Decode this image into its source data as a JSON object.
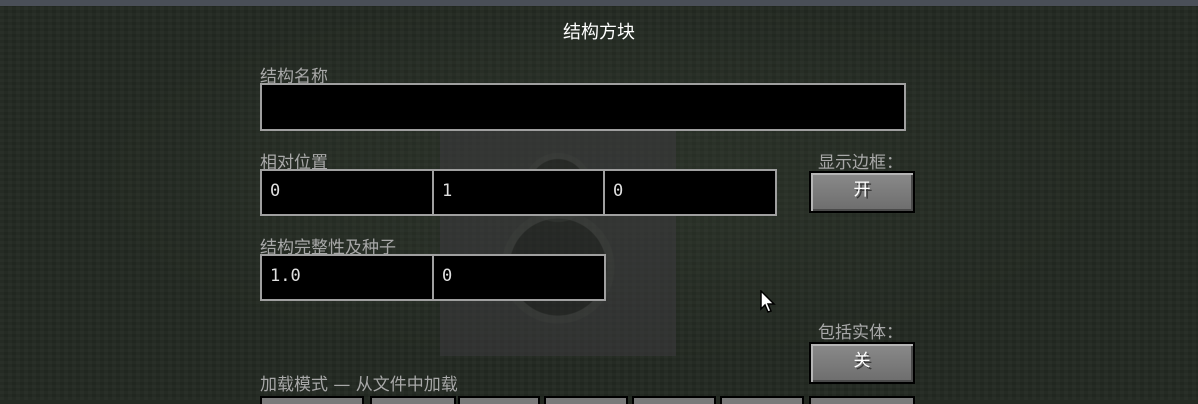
{
  "screen": {
    "title": "结构方块"
  },
  "structure_name": {
    "label": "结构名称",
    "value": ""
  },
  "relative_position": {
    "label": "相对位置",
    "x": "0",
    "y": "1",
    "z": "0"
  },
  "show_bounding_box": {
    "label": "显示边框：",
    "button": "开"
  },
  "integrity_seed": {
    "label": "结构完整性及种子",
    "integrity": "1.0",
    "seed": "0"
  },
  "include_entities": {
    "label": "包括实体：",
    "button": "关"
  },
  "load_mode": {
    "label": "加载模式 — 从文件中加载"
  }
}
